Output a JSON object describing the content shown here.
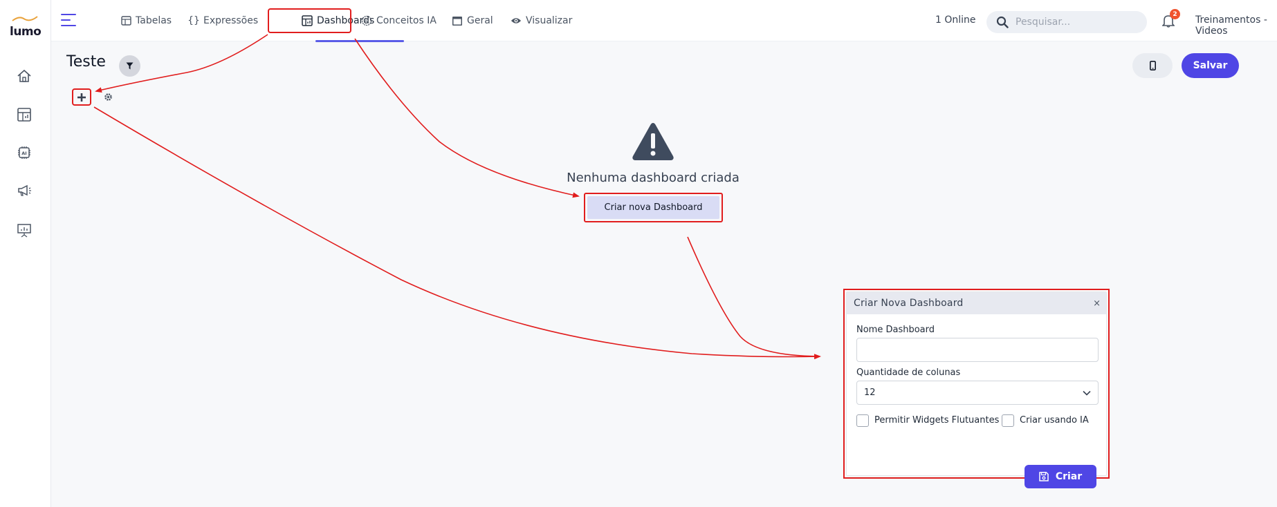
{
  "app": {
    "logo_text": "lumo"
  },
  "topnav": {
    "items": [
      {
        "label": "Tabelas",
        "icon": "table-icon"
      },
      {
        "label": "Expressões",
        "icon": "braces-icon"
      },
      {
        "label": "Dashboards",
        "icon": "dashboard-icon",
        "active": true
      },
      {
        "label": "Conceitos IA",
        "icon": "ai-icon"
      },
      {
        "label": "Geral",
        "icon": "window-icon"
      },
      {
        "label": "Visualizar",
        "icon": "eye-icon"
      }
    ],
    "online": "1 Online",
    "search_placeholder": "Pesquisar...",
    "notification_count": "2",
    "user": "Treinamentos - Videos"
  },
  "sidebar": {
    "items": [
      {
        "icon": "home-icon"
      },
      {
        "icon": "table-chart-icon"
      },
      {
        "icon": "ai-chip-icon"
      },
      {
        "icon": "megaphone-icon"
      },
      {
        "icon": "presentation-icon"
      }
    ]
  },
  "page": {
    "title": "Teste",
    "save_label": "Salvar",
    "empty_text": "Nenhuma dashboard criada",
    "create_label": "Criar nova Dashboard"
  },
  "modal": {
    "title": "Criar Nova Dashboard",
    "close": "×",
    "name_label": "Nome Dashboard",
    "name_value": "",
    "columns_label": "Quantidade de colunas",
    "columns_value": "12",
    "floating_label": "Permitir Widgets Flutuantes",
    "ai_label": "Criar usando IA",
    "submit_label": "Criar"
  },
  "colors": {
    "accent": "#4f46e5",
    "highlight": "#e11d1d",
    "badge": "#f0532e"
  }
}
